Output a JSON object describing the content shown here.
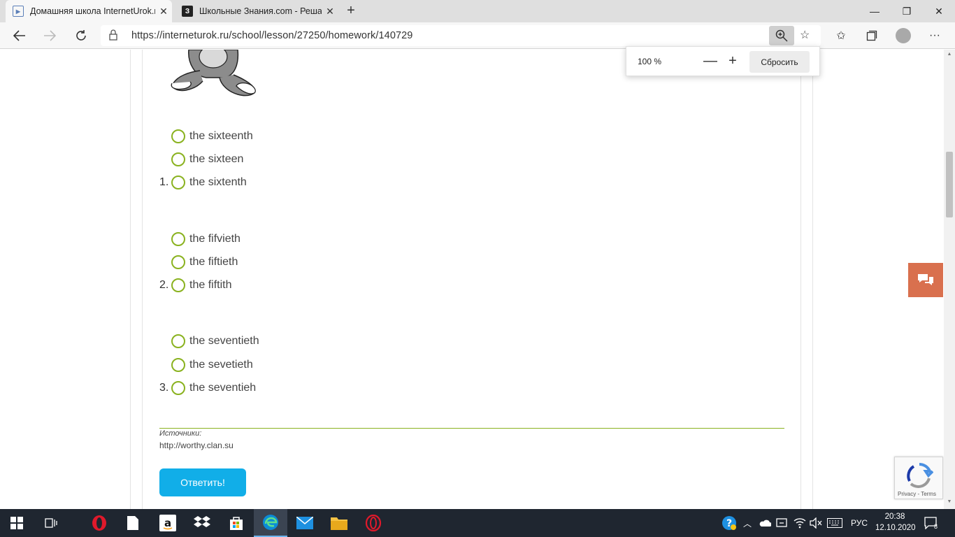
{
  "browser": {
    "tabs": [
      {
        "title": "Домашняя школа InternetUrok.ru",
        "favicon": "play-icon",
        "active": true
      },
      {
        "title": "Школьные Знания.com - Решае",
        "favicon": "znanija-icon",
        "active": false
      }
    ],
    "url": "https://interneturok.ru/school/lesson/27250/homework/140729",
    "zoom": {
      "level": "100 %",
      "minus": "—",
      "plus": "+",
      "reset_label": "Сбросить"
    }
  },
  "quiz": {
    "questions": [
      {
        "number": "1.",
        "options": [
          "the sixteenth",
          "the sixteen",
          "the sixtenth"
        ]
      },
      {
        "number": "2.",
        "options": [
          "the fifvieth",
          "the fiftieth",
          "the fiftith"
        ]
      },
      {
        "number": "3.",
        "options": [
          "the seventieth",
          "the sevetieth",
          "the seventieh"
        ]
      }
    ],
    "sources_label": "Источники:",
    "sources_link": "http://worthy.clan.su",
    "submit_label": "Ответить!"
  },
  "recaptcha": {
    "terms": "Privacy - Terms"
  },
  "taskbar": {
    "language": "РУС",
    "time": "20:38",
    "date": "12.10.2020",
    "notifications": "8"
  },
  "colors": {
    "accent_green": "#8ab21f",
    "submit_blue": "#11aee8",
    "chat_orange": "#d9704e",
    "taskbar": "#1f2630"
  }
}
